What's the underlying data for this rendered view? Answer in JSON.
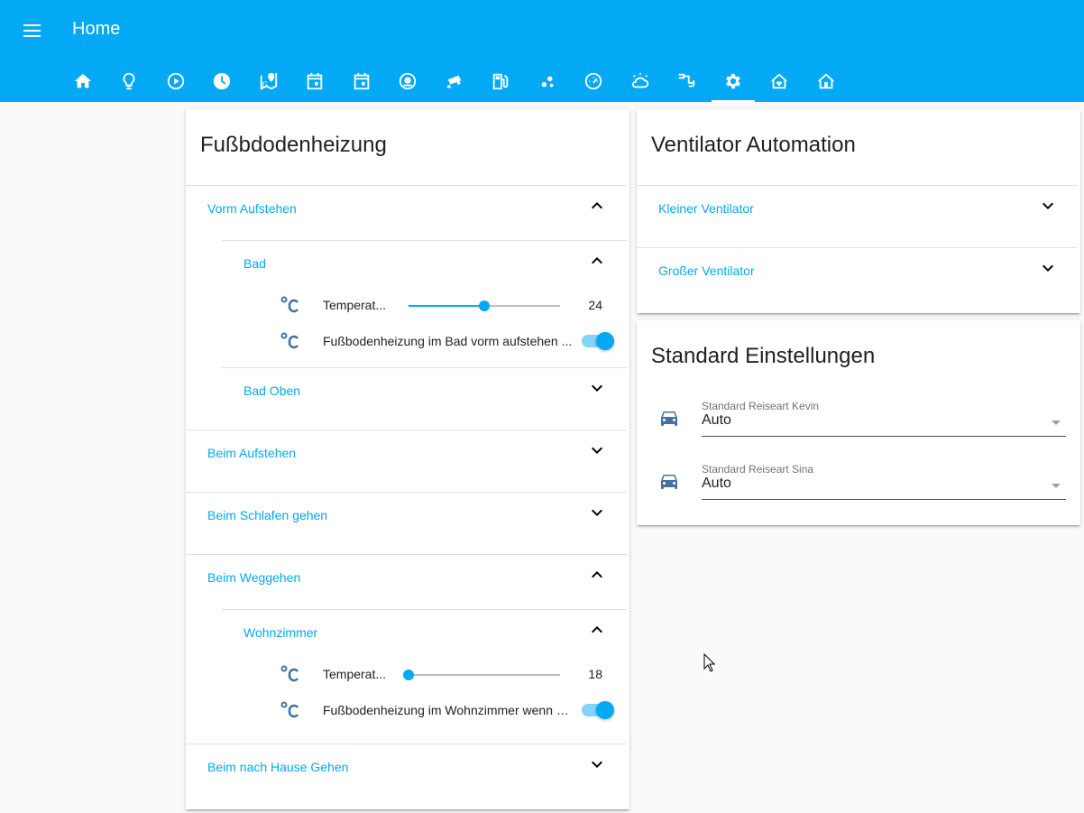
{
  "header": {
    "title": "Home",
    "tab_icons": [
      "home-icon",
      "lightbulb-icon",
      "play-circle-icon",
      "clock-icon",
      "google-maps-icon",
      "calendar-icon",
      "calendar-icon",
      "robot-vacuum-icon",
      "security-camera-icon",
      "gas-station-icon",
      "scatter-icon",
      "speedometer-icon",
      "weather-partlycloudy-icon",
      "water-pump-icon",
      "settings-icon",
      "home-heart-icon",
      "home-floor-icon"
    ],
    "active_tab": 14
  },
  "floor_heating": {
    "title": "Fußbdodenheizung",
    "groups": [
      {
        "label": "Vorm Aufstehen",
        "expanded": true
      },
      {
        "label": "Bad",
        "expanded": true
      },
      {
        "label": "Bad Oben",
        "expanded": false
      },
      {
        "label": "Beim Aufstehen",
        "expanded": false
      },
      {
        "label": "Beim Schlafen gehen",
        "expanded": false
      },
      {
        "label": "Beim Weggehen",
        "expanded": true
      },
      {
        "label": "Wohnzimmer",
        "expanded": true
      },
      {
        "label": "Beim nach Hause Gehen",
        "expanded": false
      }
    ],
    "rows": {
      "bad_temp": {
        "icon": "thermometer-celsius-icon",
        "label": "Temperat...",
        "value": "24",
        "position": 0.5
      },
      "bad_switch": {
        "icon": "thermometer-celsius-icon",
        "label": "Fußbodenheizung im Bad vorm aufstehen ...",
        "on": true
      },
      "wz_temp": {
        "icon": "thermometer-celsius-icon",
        "label": "Temperat...",
        "value": "18",
        "position": 0.0
      },
      "wz_switch": {
        "icon": "thermometer-celsius-icon",
        "label": "Fußbodenheizung im Wohnzimmer wenn w...",
        "on": true
      }
    }
  },
  "fan_automation": {
    "title": "Ventilator Automation",
    "groups": [
      {
        "label": "Kleiner Ventilator",
        "expanded": false
      },
      {
        "label": "Großer Ventilator",
        "expanded": false
      }
    ]
  },
  "default_settings": {
    "title": "Standard Einstellungen",
    "selects": [
      {
        "icon": "car-icon",
        "label": "Standard Reiseart Kevin",
        "value": "Auto"
      },
      {
        "icon": "car-icon",
        "label": "Standard Reiseart Sina",
        "value": "Auto"
      }
    ]
  },
  "colors": {
    "primary": "#03a9f4",
    "icon": "#44739e",
    "text": "#212121"
  }
}
